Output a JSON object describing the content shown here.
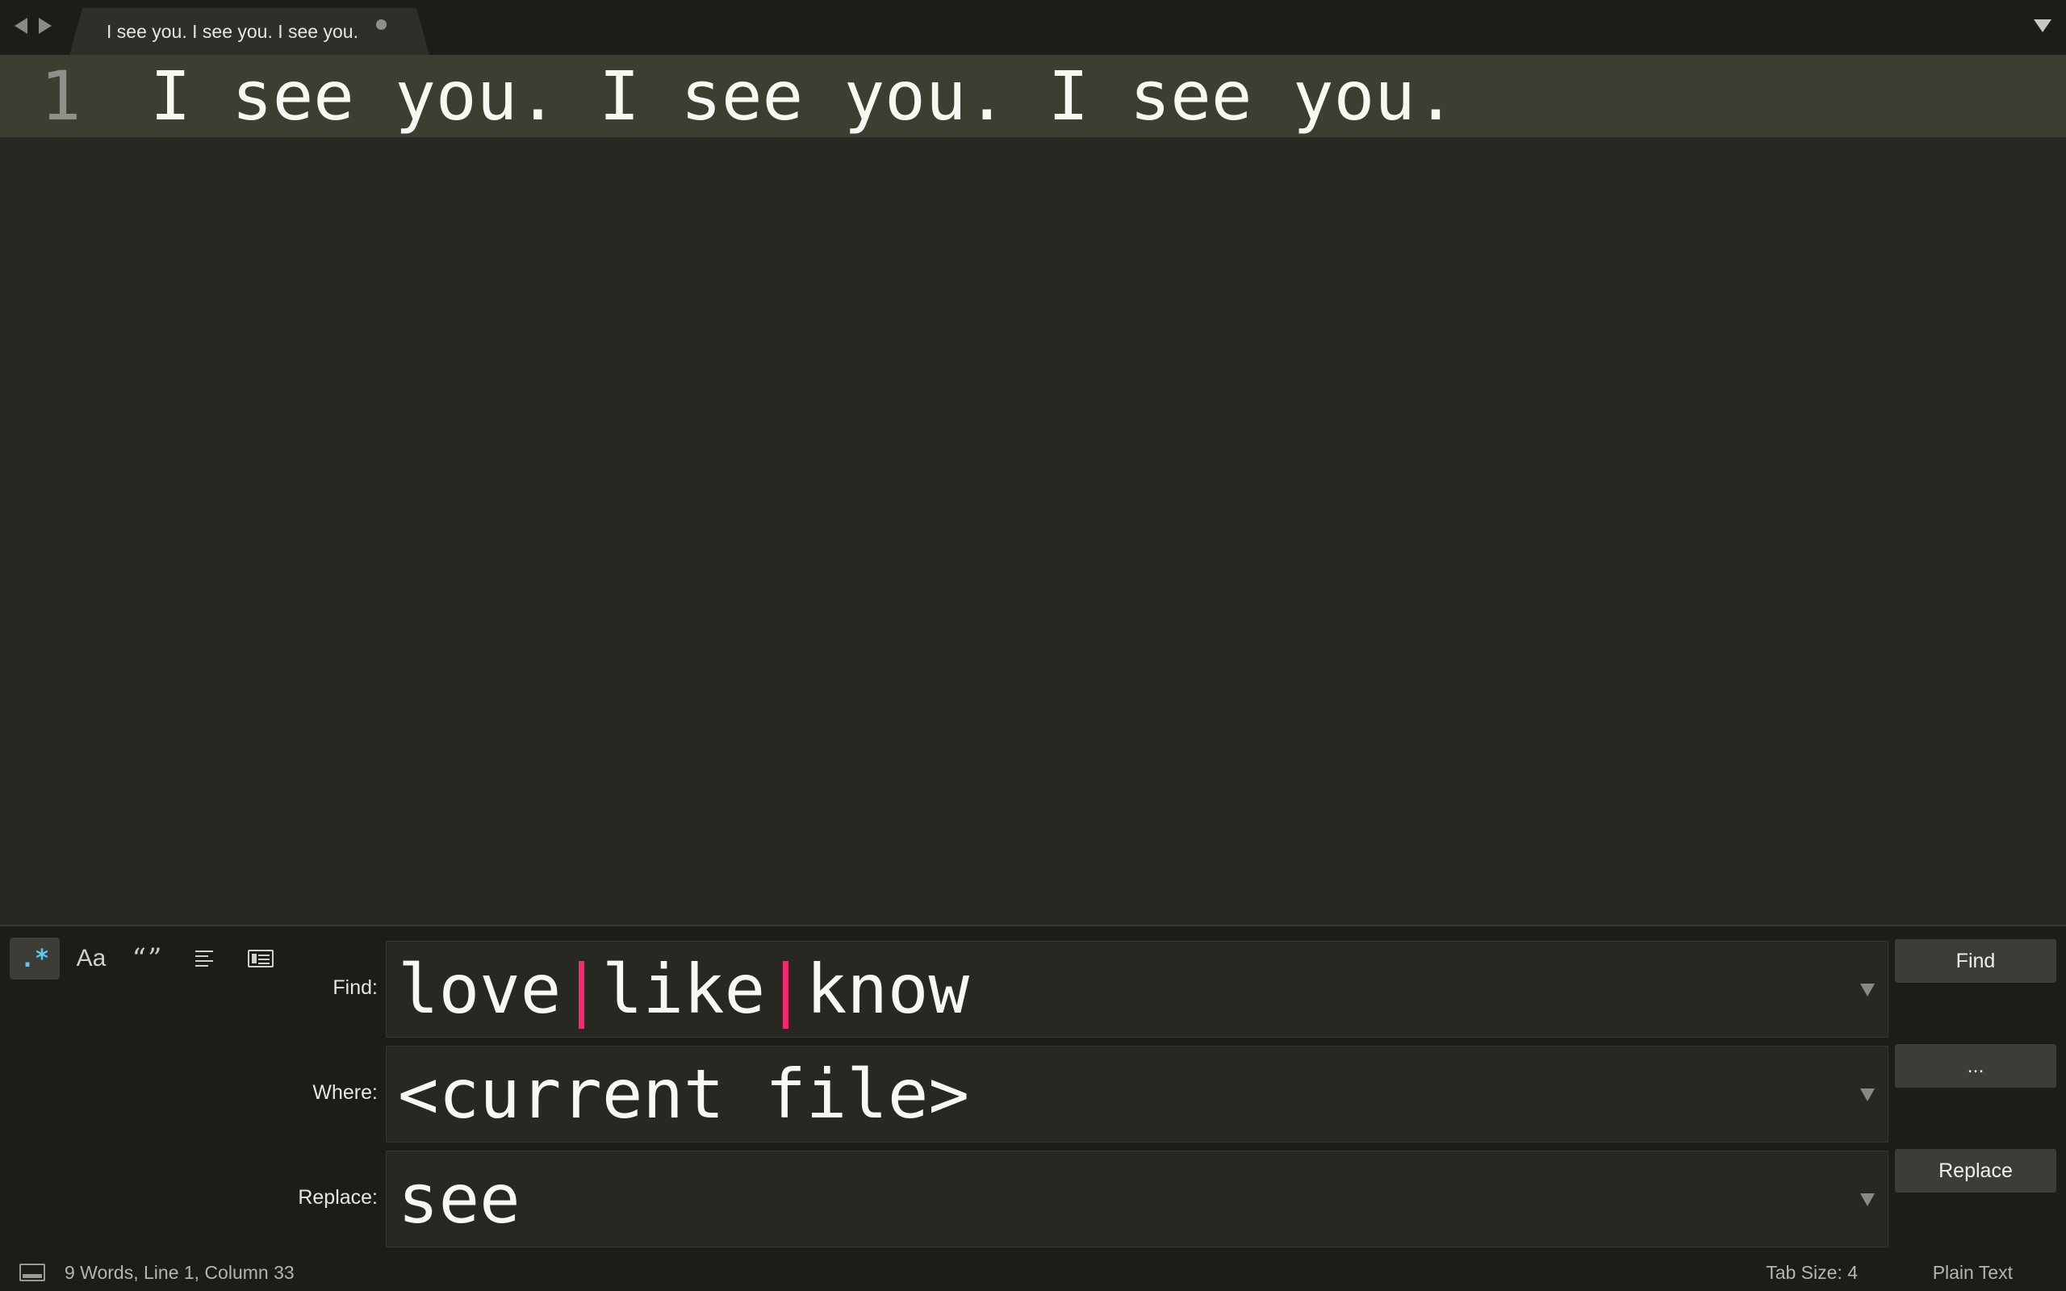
{
  "tabbar": {
    "tab_title": "I see you. I see you. I see you."
  },
  "editor": {
    "line_number": "1",
    "line_text": "I see you. I see you. I see you."
  },
  "find_panel": {
    "options": {
      "regex_label": ".*",
      "case_label": "Aa",
      "whole_word_label": "“”"
    },
    "find_label": "Find:",
    "find_parts": [
      "love",
      "|",
      "like",
      "|",
      "know"
    ],
    "where_label": "Where:",
    "where_value": "<current file>",
    "replace_label": "Replace:",
    "replace_value": "see",
    "find_button": "Find",
    "where_button": "...",
    "replace_button": "Replace"
  },
  "statusbar": {
    "status": "9 Words, Line 1, Column 33",
    "tab_size": "Tab Size: 4",
    "syntax": "Plain Text"
  },
  "colors": {
    "background": "#272822",
    "current_line": "#3e3d32",
    "regex_pipe": "#f92672",
    "regex_active": "#5ac8f5"
  }
}
